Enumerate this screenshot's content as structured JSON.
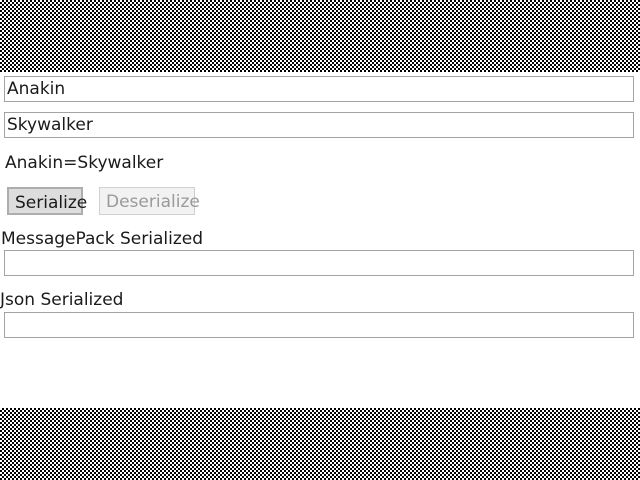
{
  "form": {
    "first_name_value": "Anakin",
    "last_name_value": "Skywalker",
    "combined_output": "Anakin=Skywalker",
    "serialize_label": "Serialize",
    "deserialize_label": "Deserialize",
    "messagepack_label": "MessagePack Serialized",
    "messagepack_value": "",
    "json_label": "Json Serialized",
    "json_value": ""
  }
}
